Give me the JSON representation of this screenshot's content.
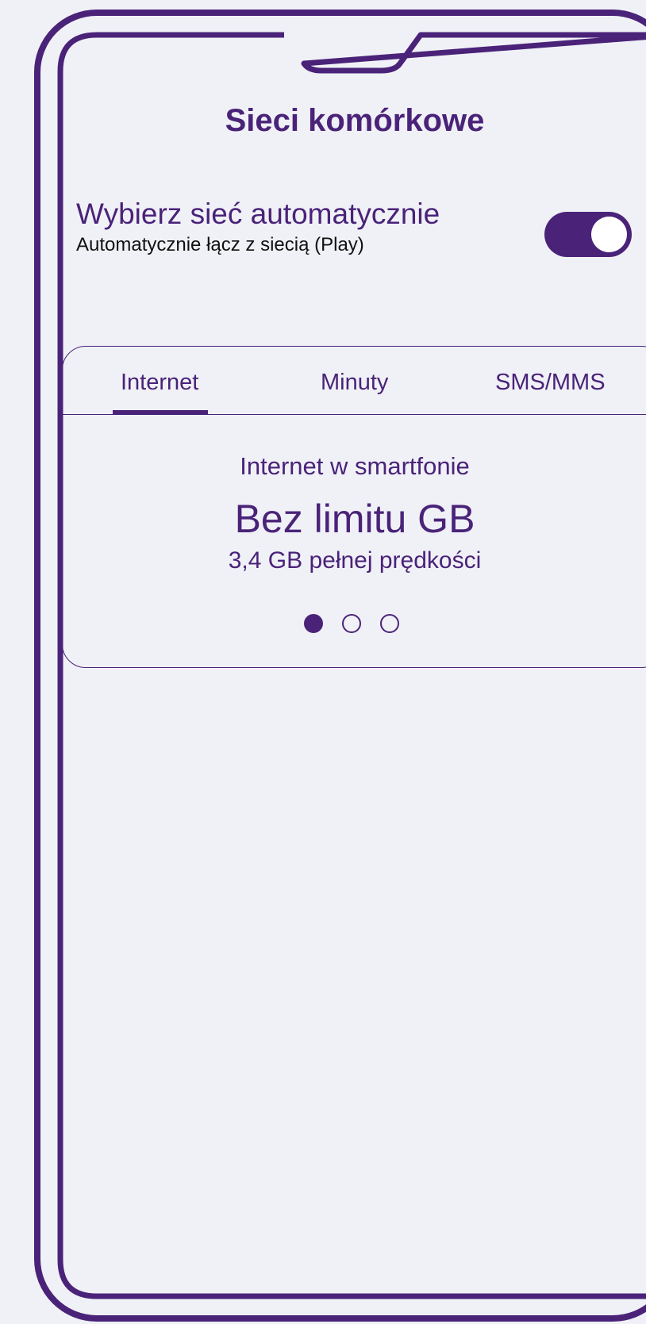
{
  "screen": {
    "title": "Sieci komórkowe"
  },
  "auto_network": {
    "title": "Wybierz sieć automatycznie",
    "subtitle": "Automatycznie łącz z siecią (Play)",
    "enabled": true
  },
  "tabs": [
    {
      "label": "Internet",
      "active": true
    },
    {
      "label": "Minuty",
      "active": false
    },
    {
      "label": "SMS/MMS",
      "active": false
    }
  ],
  "slide": {
    "label": "Internet w smartfonie",
    "main": "Bez limitu GB",
    "sub": "3,4 GB pełnej prędkości"
  },
  "pagination": {
    "current": 1,
    "total": 3
  },
  "colors": {
    "accent": "#4a2379",
    "background": "#f0f1f6",
    "knob": "#ffffff"
  }
}
